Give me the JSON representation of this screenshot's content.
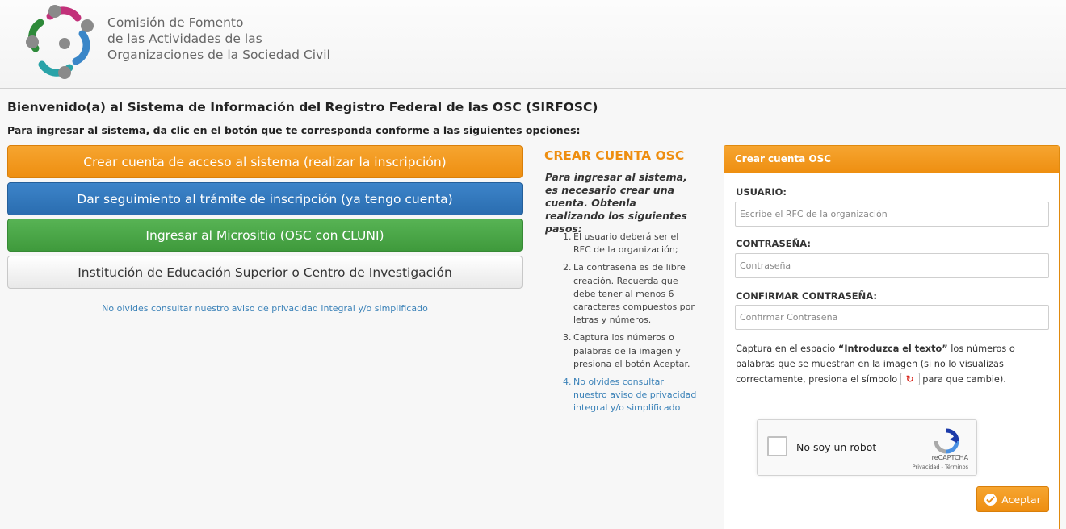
{
  "header": {
    "org_line1": "Comisión de Fomento",
    "org_line2": "de las Actividades de las",
    "org_line3": "Organizaciones de la Sociedad Civil",
    "logo_icon": "cfosc-logo-icon"
  },
  "welcome": {
    "title": "Bienvenido(a) al Sistema de Información del Registro Federal de las OSC (SIRFOSC)",
    "subtitle": "Para ingresar al sistema, da clic en el botón que te corresponda conforme a las siguientes opciones:"
  },
  "options": {
    "create_account": "Crear cuenta de acceso al sistema (realizar la inscripción)",
    "follow_up": "Dar seguimiento al trámite de inscripción (ya tengo cuenta)",
    "microsite": "Ingresar al Micrositio (OSC con CLUNI)",
    "institution": "Institución de Educación Superior o Centro de Investigación",
    "privacy_link": "No olvides consultar nuestro aviso de privacidad integral y/o simplificado"
  },
  "instructions": {
    "title": "CREAR CUENTA OSC",
    "intro": "Para ingresar al sistema, es necesario crear una cuenta. Obtenla realizando los siguientes pasos:",
    "steps": [
      {
        "num": "1.",
        "text": "El usuario deberá ser el RFC de la organización;"
      },
      {
        "num": "2.",
        "text": "La contraseña es de libre creación. Recuerda que debe tener al menos 6 caracteres compuestos por letras y números."
      },
      {
        "num": "3.",
        "text": "Captura los números o palabras de la imagen y presiona el botón Aceptar."
      },
      {
        "num": "4.",
        "text": "No olvides consultar nuestro aviso de privacidad integral y/o simplificado"
      }
    ]
  },
  "form": {
    "header": "Crear cuenta OSC",
    "usuario_label": "USUARIO:",
    "usuario_placeholder": "Escribe el RFC de la organización",
    "password_label": "CONTRASEÑA:",
    "password_placeholder": "Contraseña",
    "confirm_label": "CONFIRMAR CONTRASEÑA:",
    "confirm_placeholder": "Confirmar Contraseña",
    "captcha_prefix": "Captura en el espacio ",
    "captcha_bold": "“Introduzca el texto”",
    "captcha_mid": " los números o palabras que se muestran en la imagen (si no lo visualizas correctamente, presiona el símbolo ",
    "captcha_suffix": " para que cambie).",
    "refresh_icon": "refresh-icon",
    "recaptcha_label": "No soy un robot",
    "recaptcha_brand": "reCAPTCHA",
    "recaptcha_terms": "Privacidad - Términos",
    "accept_label": "Aceptar"
  },
  "colors": {
    "orange": "#ee8e10",
    "blue": "#2a6db0",
    "green": "#3f9a3c",
    "link": "#3b82b8"
  }
}
